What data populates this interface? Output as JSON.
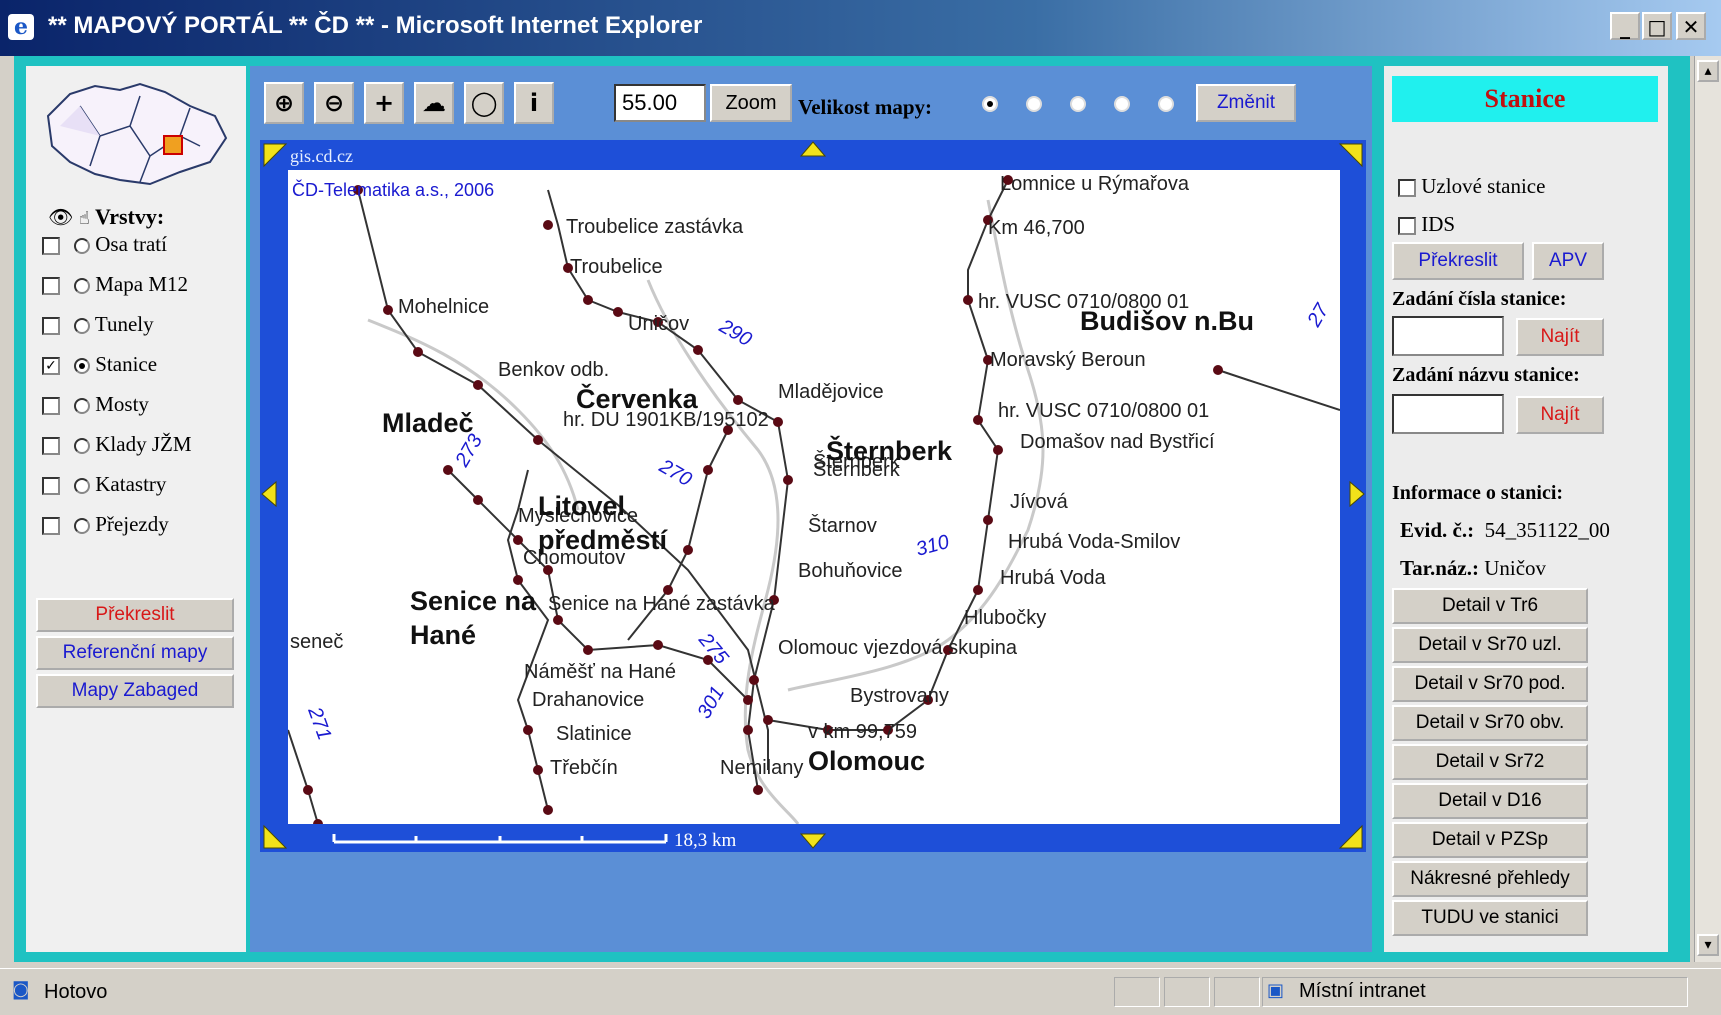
{
  "window": {
    "title": "** MAPOVÝ PORTÁL ** ČD ** - Microsoft Internet Explorer",
    "min_icon": "_",
    "max_icon": "□",
    "close_icon": "✕"
  },
  "left": {
    "layers_title": "Vrstvy:",
    "layers": [
      {
        "label": "Osa tratí",
        "checked": false,
        "selected": false
      },
      {
        "label": "Mapa M12",
        "checked": false,
        "selected": false
      },
      {
        "label": "Tunely",
        "checked": false,
        "selected": false
      },
      {
        "label": "Stanice",
        "checked": true,
        "selected": true
      },
      {
        "label": "Mosty",
        "checked": false,
        "selected": false
      },
      {
        "label": "Klady JŽM",
        "checked": false,
        "selected": false
      },
      {
        "label": "Katastry",
        "checked": false,
        "selected": false
      },
      {
        "label": "Přejezdy",
        "checked": false,
        "selected": false
      }
    ],
    "buttons": [
      "Překreslit",
      "Referenční mapy",
      "Mapy Zabaged"
    ]
  },
  "toolbar": {
    "tools": [
      {
        "icon": "zoom-in-icon",
        "glyph": "⊕"
      },
      {
        "icon": "zoom-out-icon",
        "glyph": "⊖"
      },
      {
        "icon": "pan-icon",
        "glyph": "+"
      },
      {
        "icon": "full-extent-icon",
        "glyph": "☁"
      },
      {
        "icon": "zoom-window-icon",
        "glyph": "◯"
      },
      {
        "icon": "info-icon",
        "glyph": "i"
      }
    ],
    "zoom_value": "55.00",
    "zoom_label": "Zoom",
    "map_size_label": "Velikost mapy:",
    "map_size_options": 5,
    "map_size_selected": 0,
    "change_label": "Změnit"
  },
  "map": {
    "source": "gis.cd.cz",
    "copyright": "ČD-Telematika a.s., 2006",
    "scale_label": "18,3 km",
    "stations": [
      "Troubelice zastávka",
      "Troubelice",
      "Mohelnice",
      "Uničov",
      "Benkov odb.",
      "Mladějovice",
      "hr. DU 1901KB/195102",
      "Šternberk",
      "Šternberk",
      "Myslechovice",
      "Chomoutov",
      "Štarnov",
      "Bohuňovice",
      "Senice na Hané zastávka",
      "Olomouc vjezdová skupina",
      "Náměšť na Hané",
      "Drahanovice",
      "Slatinice",
      "Třebčín",
      "Nemilany",
      "Bystrovany",
      "v km 99,759",
      "Lomnice u Rýmařova",
      "Km 46,700",
      "hr. VUSC 0710/0800 01",
      "Moravský Beroun",
      "hr. VUSC 0710/0800 01",
      "Domašov nad Bystřicí",
      "Jívová",
      "Hrubá Voda-Smilov",
      "Hrubá Voda",
      "Hlubočky",
      "seneč"
    ],
    "towns": [
      "Červenka",
      "Mladeč",
      "Šternberk",
      "Litovel předměstí",
      "Senice na Hané",
      "Olomouc",
      "Budišov n.Bu"
    ],
    "line_numbers": [
      "290",
      "273",
      "270",
      "275",
      "301",
      "310",
      "271",
      "27"
    ]
  },
  "right": {
    "header": "Stanice",
    "opt_uzlove": "Uzlové stanice",
    "opt_ids": "IDS",
    "btn_redraw": "Překreslit",
    "btn_apv": "APV",
    "label_number": "Zadání čísla stanice:",
    "label_name": "Zadání názvu stanice:",
    "btn_find": "Najít",
    "info_title": "Informace o stanici:",
    "evid_label": "Evid. č.:",
    "evid_value": "54_351122_00",
    "tar_label": "Tar.náz.:",
    "tar_value": "Uničov",
    "details": [
      "Detail v Tr6",
      "Detail v Sr70 uzl.",
      "Detail v Sr70 pod.",
      "Detail v Sr70 obv.",
      "Detail v Sr72",
      "Detail v D16",
      "Detail v PZSp",
      "Nákresné přehledy",
      "TUDU ve stanici"
    ]
  },
  "status": {
    "text": "Hotovo",
    "zone": "Místní intranet"
  },
  "colors": {
    "frame": "#1fc2c2",
    "map_border": "#1e4fd8",
    "map_bg": "#5b8fd6",
    "header_bg": "#20f0ee",
    "header_text": "#c01010",
    "station_dot": "#5a0a14"
  }
}
